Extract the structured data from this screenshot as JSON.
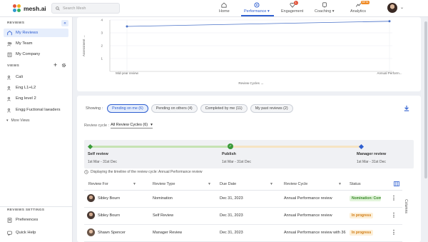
{
  "app": {
    "name": "mesh.ai"
  },
  "search": {
    "placeholder": "Search Mesh"
  },
  "nav": [
    {
      "label": "Home",
      "icon": "home-icon"
    },
    {
      "label": "Performance",
      "icon": "performance-icon",
      "active": true
    },
    {
      "label": "Engagement",
      "icon": "engagement-icon",
      "badge": "1"
    },
    {
      "label": "Coaching",
      "icon": "coaching-icon"
    },
    {
      "label": "Analytics",
      "icon": "analytics-icon",
      "badge": "BETA"
    }
  ],
  "sidebar": {
    "reviews_title": "REVIEWS",
    "reviews": [
      {
        "label": "My Reviews",
        "active": true
      },
      {
        "label": "My Team"
      },
      {
        "label": "My Company"
      }
    ],
    "views_title": "VIEWS",
    "views": [
      {
        "label": "Cali"
      },
      {
        "label": "Eng L1+L2"
      },
      {
        "label": "Eng level 2"
      },
      {
        "label": "Engg Fuctional laeaders"
      }
    ],
    "more_views": "More Views",
    "settings_title": "REVIEWS SETTINGS",
    "preferences": "Preferences",
    "quick_help": "Quick Help"
  },
  "chart_data": {
    "type": "line",
    "categories": [
      "Mid-year review",
      "Annual Perform..."
    ],
    "series": [
      {
        "values": [
          3.5,
          3.9
        ]
      }
    ],
    "y_ticks": [
      "4",
      "3",
      "2",
      "1"
    ],
    "ylim": [
      0,
      4
    ],
    "ylabel": "Assessment →",
    "xlabel": "Review Cycles →",
    "color": "#4a72c8",
    "grid": true
  },
  "filters": {
    "showing_label": "Showing :",
    "chips": [
      {
        "label": "Pending on me (6)",
        "active": true
      },
      {
        "label": "Pending on others (4)"
      },
      {
        "label": "Completed by me (11)"
      },
      {
        "label": "My past reviews (2)"
      }
    ]
  },
  "cycle": {
    "label": "Review cycle :",
    "value": "All Review Cycles (6)"
  },
  "timeline": {
    "stages": [
      {
        "label": "Self review",
        "dates": "1st Mar - 31st Dec",
        "color": "#3a9a3a"
      },
      {
        "label": "Publish",
        "dates": "1st Mar - 31st Dec",
        "color": "#3a9a3a"
      },
      {
        "label": "Manager review",
        "dates": "1st Mar - 31st Dec",
        "color": "#2f5fd0"
      }
    ],
    "info": "Displaying the timeline of the review cycle: Annual Performance review"
  },
  "table": {
    "headers": [
      "Review For",
      "Review Type",
      "Due Date",
      "Review Cycle",
      "Status"
    ],
    "columns_label": "Columns",
    "rows": [
      {
        "review_for": "Sibley Bourn",
        "type": "Nomination",
        "due": "Dec 31, 2023",
        "cycle": "Annual Performance review",
        "status": "Nomination: Comp",
        "status_bg": "#e3f5dc",
        "status_fg": "#3a8a2a"
      },
      {
        "review_for": "Sibley Bourn",
        "type": "Self Review",
        "due": "Dec 31, 2023",
        "cycle": "Annual Performance review",
        "status": "In progress",
        "status_bg": "#fdf0d9",
        "status_fg": "#d07a10"
      },
      {
        "review_for": "Shawn Spencer",
        "type": "Manager Review",
        "due": "Dec 31, 2023",
        "cycle": "Annual Performance review with 36",
        "status": "In progress",
        "status_bg": "#fdf0d9",
        "status_fg": "#d07a10"
      }
    ]
  }
}
